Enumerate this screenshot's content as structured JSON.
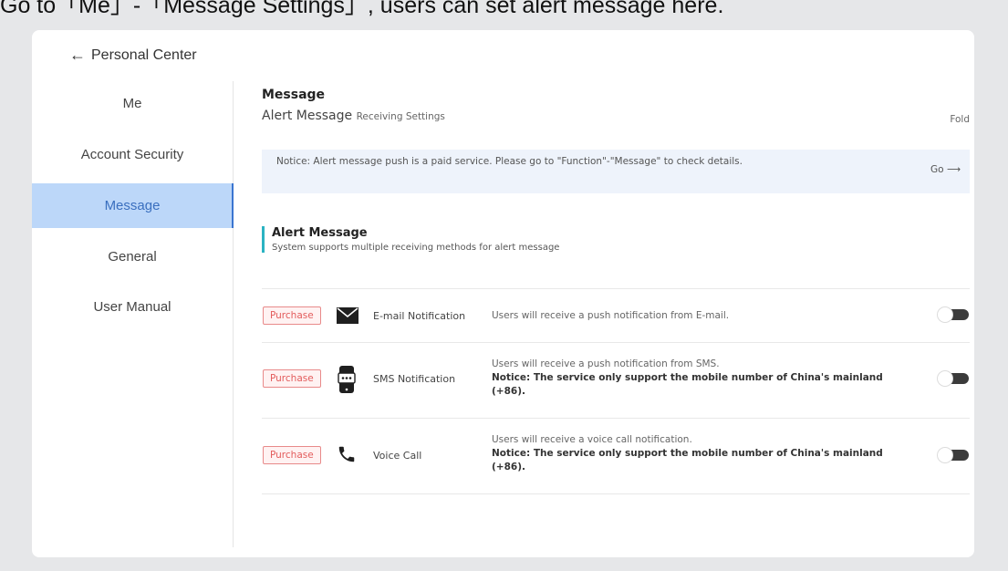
{
  "caption": "Go to「Me」-「Message Settings」, users can set alert message here.",
  "back_label": "Personal Center",
  "sidebar": {
    "items": [
      {
        "label": "Me"
      },
      {
        "label": "Account Security"
      },
      {
        "label": "Message",
        "active": true
      },
      {
        "label": "General"
      },
      {
        "label": "User Manual"
      }
    ]
  },
  "main": {
    "title": "Message",
    "subtitle_main": "Alert Message",
    "subtitle_small": "Receiving Settings",
    "fold_label": "Fold",
    "notice_text": "Notice: Alert message push is a paid service. Please go to \"Function\"-\"Message\" to check details.",
    "go_label": "Go",
    "section_title": "Alert Message",
    "section_desc": "System supports multiple receiving methods for alert message",
    "purchase_label": "Purchase",
    "rows": [
      {
        "icon": "mail-icon",
        "name": "E-mail Notification",
        "desc": "Users will receive a push notification from E-mail.",
        "notice": "",
        "enabled": false
      },
      {
        "icon": "sms-icon",
        "name": "SMS Notification",
        "desc": "Users will receive a push notification from SMS.",
        "notice": "Notice: The service only support the mobile number of China's mainland (+86).",
        "enabled": false
      },
      {
        "icon": "phone-icon",
        "name": "Voice Call",
        "desc": "Users will receive a voice call notification.",
        "notice": "Notice: The service only support the mobile number of China's mainland (+86).",
        "enabled": false
      }
    ]
  },
  "colors": {
    "page_bg": "#e6e7e9",
    "active_bg": "#bcd7f9",
    "active_text": "#3a6fbf",
    "section_accent": "#2bb3c2",
    "purchase": "#e35c5c",
    "notice_bg": "#eef3fb"
  }
}
